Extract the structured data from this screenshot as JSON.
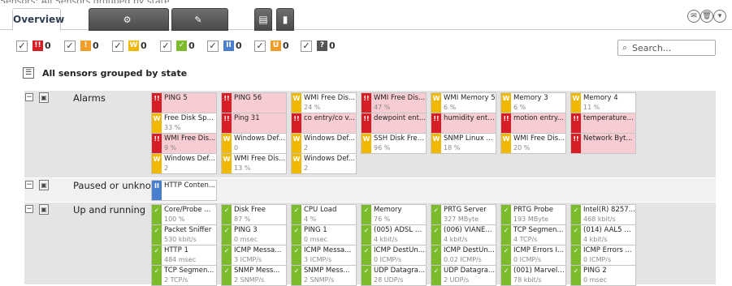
{
  "colors": {
    "red": "#d71e27",
    "yellow": "#f0b800",
    "green": "#7cbb2b",
    "blue": "#4a7fd0",
    "orange": "#f29c2b",
    "grey": "#555555",
    "row_bg": "#e4e4e4",
    "red_tile": "#f7cdd3"
  },
  "top_cut_text": "Sensors: All Sensors grouped by state",
  "tabs": {
    "overview": "Overview",
    "management": "Management",
    "settings": "Settings"
  },
  "filters": [
    {
      "name": "down",
      "icon": "!!",
      "color": "#d71e27",
      "count": "0"
    },
    {
      "name": "unusual",
      "icon": "!",
      "color": "#f29c2b",
      "count": "0"
    },
    {
      "name": "warning",
      "icon": "W",
      "color": "#f0b800",
      "count": "0"
    },
    {
      "name": "up",
      "icon": "✓",
      "color": "#7cbb2b",
      "count": "0"
    },
    {
      "name": "paused",
      "icon": "II",
      "color": "#4a7fd0",
      "count": "0"
    },
    {
      "name": "unknown-orange",
      "icon": "U",
      "color": "#f29c2b",
      "count": "0"
    },
    {
      "name": "unknown",
      "icon": "?",
      "color": "#555555",
      "count": "0"
    }
  ],
  "search": {
    "placeholder": "Search..."
  },
  "group_title": "All sensors grouped by state",
  "rows": [
    {
      "label": "Alarms",
      "tiles": [
        {
          "name": "PING 5",
          "value": "",
          "state": "red"
        },
        {
          "name": "PING 56",
          "value": "",
          "state": "red"
        },
        {
          "name": "WMI Free Dis...",
          "value": "24 %",
          "state": "yellow"
        },
        {
          "name": "WMI Free Dis...",
          "value": "47 %",
          "state": "red"
        },
        {
          "name": "WMI Memory 5",
          "value": "6 %",
          "state": "yellow"
        },
        {
          "name": "Memory 3",
          "value": "6 %",
          "state": "yellow"
        },
        {
          "name": "Memory 4",
          "value": "11 %",
          "state": "yellow"
        },
        {
          "name": "Free Disk Spa...",
          "value": "33 %",
          "state": "yellow"
        },
        {
          "name": "Ping 31",
          "value": "",
          "state": "red"
        },
        {
          "name": "co entry/co v...",
          "value": "",
          "state": "red"
        },
        {
          "name": "dewpoint ent...",
          "value": "",
          "state": "red"
        },
        {
          "name": "humidity entr...",
          "value": "",
          "state": "red"
        },
        {
          "name": "motion entry...",
          "value": "",
          "state": "red"
        },
        {
          "name": "temperature ...",
          "value": "",
          "state": "red"
        },
        {
          "name": "WMI Free Dis...",
          "value": "9 %",
          "state": "red"
        },
        {
          "name": "Windows Def...",
          "value": "0",
          "state": "yellow"
        },
        {
          "name": "Windows Def...",
          "value": "2",
          "state": "yellow"
        },
        {
          "name": "SSH Disk Free 1",
          "value": "96 %",
          "state": "yellow"
        },
        {
          "name": "SNMP Linux ...",
          "value": "18 %",
          "state": "yellow"
        },
        {
          "name": "WMI Free Dis...",
          "value": "20 %",
          "state": "yellow"
        },
        {
          "name": "Network Byt...",
          "value": "",
          "state": "red"
        },
        {
          "name": "Windows Def...",
          "value": "2",
          "state": "yellow"
        },
        {
          "name": "WMI Free Dis...",
          "value": "13 %",
          "state": "yellow"
        },
        {
          "name": "Windows Def...",
          "value": "2",
          "state": "yellow"
        }
      ]
    },
    {
      "label": "Paused or unknown",
      "tiles": [
        {
          "name": "HTTP Conten...",
          "value": "",
          "state": "blue"
        }
      ]
    },
    {
      "label": "Up and running",
      "tiles": [
        {
          "name": "Core/Probe ...",
          "value": "100 %",
          "state": "green"
        },
        {
          "name": "Disk Free",
          "value": "87 %",
          "state": "green"
        },
        {
          "name": "CPU Load",
          "value": "4 %",
          "state": "green"
        },
        {
          "name": "Memory",
          "value": "76 %",
          "state": "green"
        },
        {
          "name": "PRTG Server",
          "value": "327 MByte",
          "state": "green"
        },
        {
          "name": "PRTG Probe",
          "value": "193 MByte",
          "state": "green"
        },
        {
          "name": "Intel(R) 8257...",
          "value": "468 kbit/s",
          "state": "green"
        },
        {
          "name": "Packet Sniffer",
          "value": "530 kbit/s",
          "state": "green"
        },
        {
          "name": "PING 3",
          "value": "0 msec",
          "state": "green"
        },
        {
          "name": "PING 1",
          "value": "0 msec",
          "state": "green"
        },
        {
          "name": "(005) ADSL p...",
          "value": "4 kbit/s",
          "state": "green"
        },
        {
          "name": "(006) VIANE...",
          "value": "4 kbit/s",
          "state": "green"
        },
        {
          "name": "TCP Segmen...",
          "value": "4 TCP/s",
          "state": "green"
        },
        {
          "name": "(014) AAL5 C...",
          "value": "4 kbit/s",
          "state": "green"
        },
        {
          "name": "HTTP 1",
          "value": "484 msec",
          "state": "green"
        },
        {
          "name": "ICMP Messa...",
          "value": "3 ICMP/s",
          "state": "green"
        },
        {
          "name": "ICMP Messa...",
          "value": "3 ICMP/s",
          "state": "green"
        },
        {
          "name": "ICMP DestUn...",
          "value": "0 ICMP/s",
          "state": "green"
        },
        {
          "name": "ICMP DestUn...",
          "value": "0.02 ICMP/s",
          "state": "green"
        },
        {
          "name": "ICMP Errors I...",
          "value": "0 ICMP/s",
          "state": "green"
        },
        {
          "name": "ICMP Errors ...",
          "value": "0 ICMP/s",
          "state": "green"
        },
        {
          "name": "TCP Segmen...",
          "value": "2 TCP/s",
          "state": "green"
        },
        {
          "name": "SNMP Mess...",
          "value": "2 SNMP/s",
          "state": "green"
        },
        {
          "name": "SNMP Mess...",
          "value": "2 SNMP/s",
          "state": "green"
        },
        {
          "name": "UDP Datagra...",
          "value": "28 UDP/s",
          "state": "green"
        },
        {
          "name": "UDP Datagra...",
          "value": "2 UDP/s",
          "state": "green"
        },
        {
          "name": "(001) Marvell...",
          "value": "78 kbit/s",
          "state": "green"
        },
        {
          "name": "PING 2",
          "value": "0 msec",
          "state": "green"
        }
      ]
    }
  ]
}
